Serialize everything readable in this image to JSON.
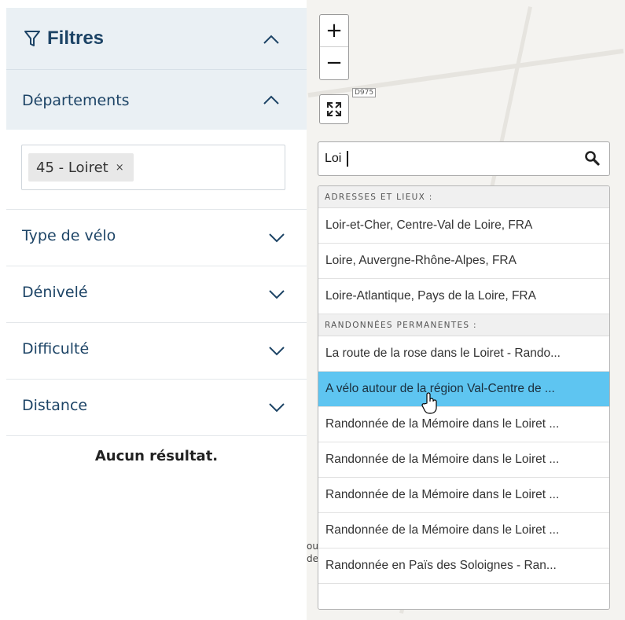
{
  "filters": {
    "title": "Filtres",
    "departements_label": "Départements",
    "selected_chip": "45 - Loiret",
    "chip_remove": "×",
    "sections": [
      {
        "label": "Type de vélo"
      },
      {
        "label": "Dénivelé"
      },
      {
        "label": "Difficulté"
      },
      {
        "label": "Distance"
      }
    ],
    "no_result": "Aucun résultat."
  },
  "map": {
    "zoom_in": "+",
    "zoom_out": "−",
    "road_label": "D975",
    "text_fragments": [
      "ou",
      "de"
    ]
  },
  "search": {
    "value": "Loi"
  },
  "dropdown": {
    "groups": [
      {
        "header": "ADRESSES ET LIEUX :",
        "items": [
          "Loir-et-Cher, Centre-Val de Loire, FRA",
          "Loire, Auvergne-Rhône-Alpes, FRA",
          "Loire-Atlantique, Pays de la Loire, FRA"
        ]
      },
      {
        "header": "RANDONNÉES PERMANENTES :",
        "items": [
          "La route de la rose dans le Loiret - Rando...",
          "A vélo autour de la région Val-Centre de ...",
          "Randonnée de la Mémoire dans le Loiret ...",
          "Randonnée de la Mémoire dans le Loiret ...",
          "Randonnée de la Mémoire dans le Loiret ...",
          "Randonnée de la Mémoire dans le Loiret ...",
          "Randonnée en Païs des Soloignes - Ran..."
        ]
      }
    ],
    "active_item_index": 1
  },
  "colors": {
    "panel_header_bg": "#eaf0f4",
    "title_color": "#1d4466",
    "active_item_bg": "#5ec5f1"
  }
}
